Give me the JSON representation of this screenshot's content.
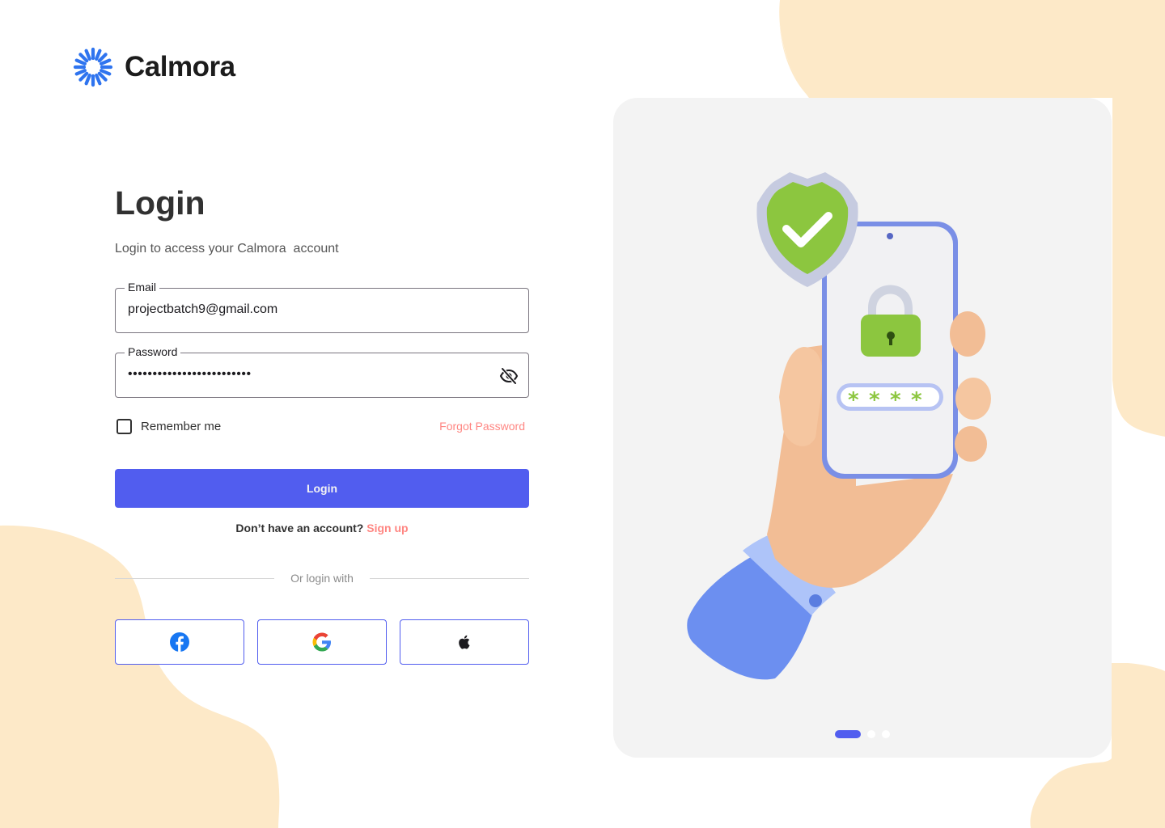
{
  "brand": {
    "name": "Calmora",
    "icon": "sunburst-logo-icon",
    "color": "#2f74ef"
  },
  "login": {
    "title": "Login",
    "subtitle": "Login to access your Calmora  account",
    "email": {
      "label": "Email",
      "value": "projectbatch9@gmail.com"
    },
    "password": {
      "label": "Password",
      "value": "•••••••••••••••••••••••••",
      "toggle_icon": "eye-off-icon"
    },
    "remember_label": "Remember me",
    "remember_checked": false,
    "forgot_label": "Forgot Password",
    "submit_label": "Login",
    "signup_prompt": "Don’t have an account?",
    "signup_link": "Sign up",
    "divider_text": "Or login with",
    "social": [
      {
        "name": "Facebook",
        "icon": "facebook-icon"
      },
      {
        "name": "Google",
        "icon": "google-icon"
      },
      {
        "name": "Apple",
        "icon": "apple-icon"
      }
    ]
  },
  "carousel": {
    "slides": 3,
    "active": 1,
    "illustration": "hand-holding-phone-with-lock-and-shield"
  },
  "colors": {
    "primary": "#515def",
    "accent": "#ff8682",
    "blob": "#fde9c8",
    "card": "#f3f3f3"
  }
}
